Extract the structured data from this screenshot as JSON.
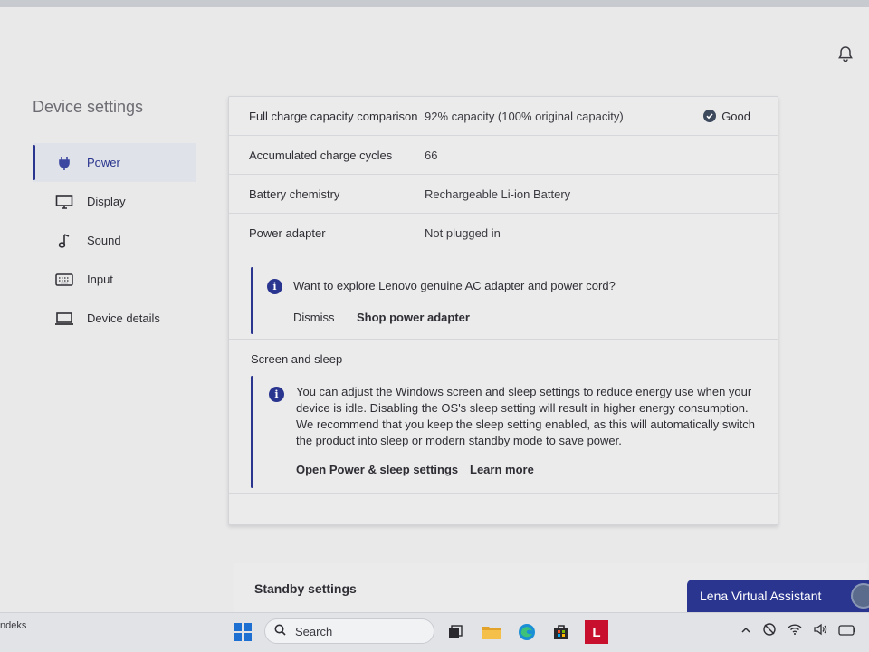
{
  "app": {
    "title": "Device settings"
  },
  "nav": {
    "items": [
      {
        "label": "Power",
        "icon": "plug-icon",
        "active": true
      },
      {
        "label": "Display",
        "icon": "monitor-icon",
        "active": false
      },
      {
        "label": "Sound",
        "icon": "music-note-icon",
        "active": false
      },
      {
        "label": "Input",
        "icon": "keyboard-icon",
        "active": false
      },
      {
        "label": "Device details",
        "icon": "laptop-icon",
        "active": false
      }
    ]
  },
  "battery": {
    "rows": [
      {
        "key": "Full charge capacity comparison",
        "value": "92% capacity (100% original capacity)",
        "status": "Good"
      },
      {
        "key": "Accumulated charge cycles",
        "value": "66"
      },
      {
        "key": "Battery chemistry",
        "value": "Rechargeable Li-ion Battery"
      },
      {
        "key": "Power adapter",
        "value": "Not plugged in"
      }
    ]
  },
  "adapter_notice": {
    "message": "Want to explore Lenovo genuine AC adapter and power cord?",
    "dismiss_label": "Dismiss",
    "shop_label": "Shop power adapter"
  },
  "screen_sleep": {
    "title": "Screen and sleep",
    "message_lines": [
      "You can adjust the Windows screen and sleep settings to reduce energy use when your",
      "device is idle. Disabling the OS's sleep setting will result in higher energy consumption.",
      "We recommend that you keep the sleep setting enabled, as this will automatically switch",
      "the product into sleep or modern standby mode to save power."
    ],
    "open_settings_label": "Open Power & sleep settings",
    "learn_more_label": "Learn more"
  },
  "standby": {
    "title": "Standby settings"
  },
  "assistant": {
    "label": "Lena Virtual Assistant"
  },
  "taskbar": {
    "left_text": "ndeks",
    "search_placeholder": "Search",
    "lenovo_app_letter": "L"
  },
  "colors": {
    "accent": "#2a358f",
    "status_good": "#3d4a5e"
  }
}
